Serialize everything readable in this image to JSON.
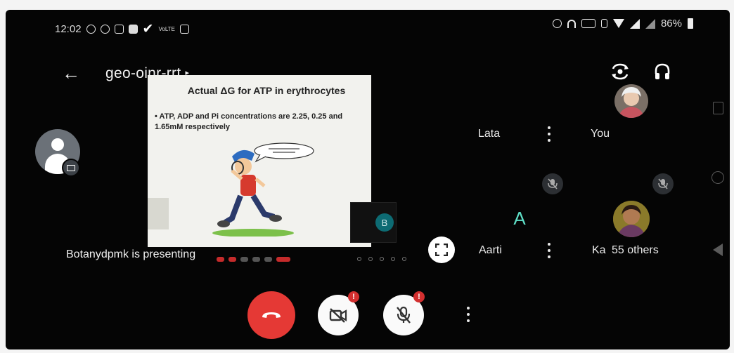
{
  "status_bar": {
    "time": "12:02",
    "left_icons": [
      "record-icon",
      "whatsapp-icon",
      "gmail-icon",
      "gallery-icon",
      "check-icon",
      "network-label-icon",
      "screen-icon"
    ],
    "battery": "86%"
  },
  "toolbar": {
    "meeting_code": "geo-oinr-rrt",
    "caret": "▸"
  },
  "presentation": {
    "slide_title": "Actual ΔG for ATP in erythrocytes",
    "slide_bullet": "• ATP, ADP and Pi concentrations are 2.25, 0.25 and 1.65mM respectively",
    "presenter_label": "Botanydpmk is presenting",
    "mini_tile_initial": "B"
  },
  "participants": {
    "lata": {
      "name": "Lata"
    },
    "you": {
      "name": "You"
    },
    "aarti": {
      "name": "Aarti",
      "initial": "A",
      "avatar_color": "#5fe0c8"
    },
    "others": {
      "name": "Ka",
      "label": "55 others"
    }
  },
  "controls": {
    "badge": "!"
  },
  "colors": {
    "end_call": "#e53935",
    "badge": "#d32f2f",
    "screen_bg": "#050505"
  }
}
